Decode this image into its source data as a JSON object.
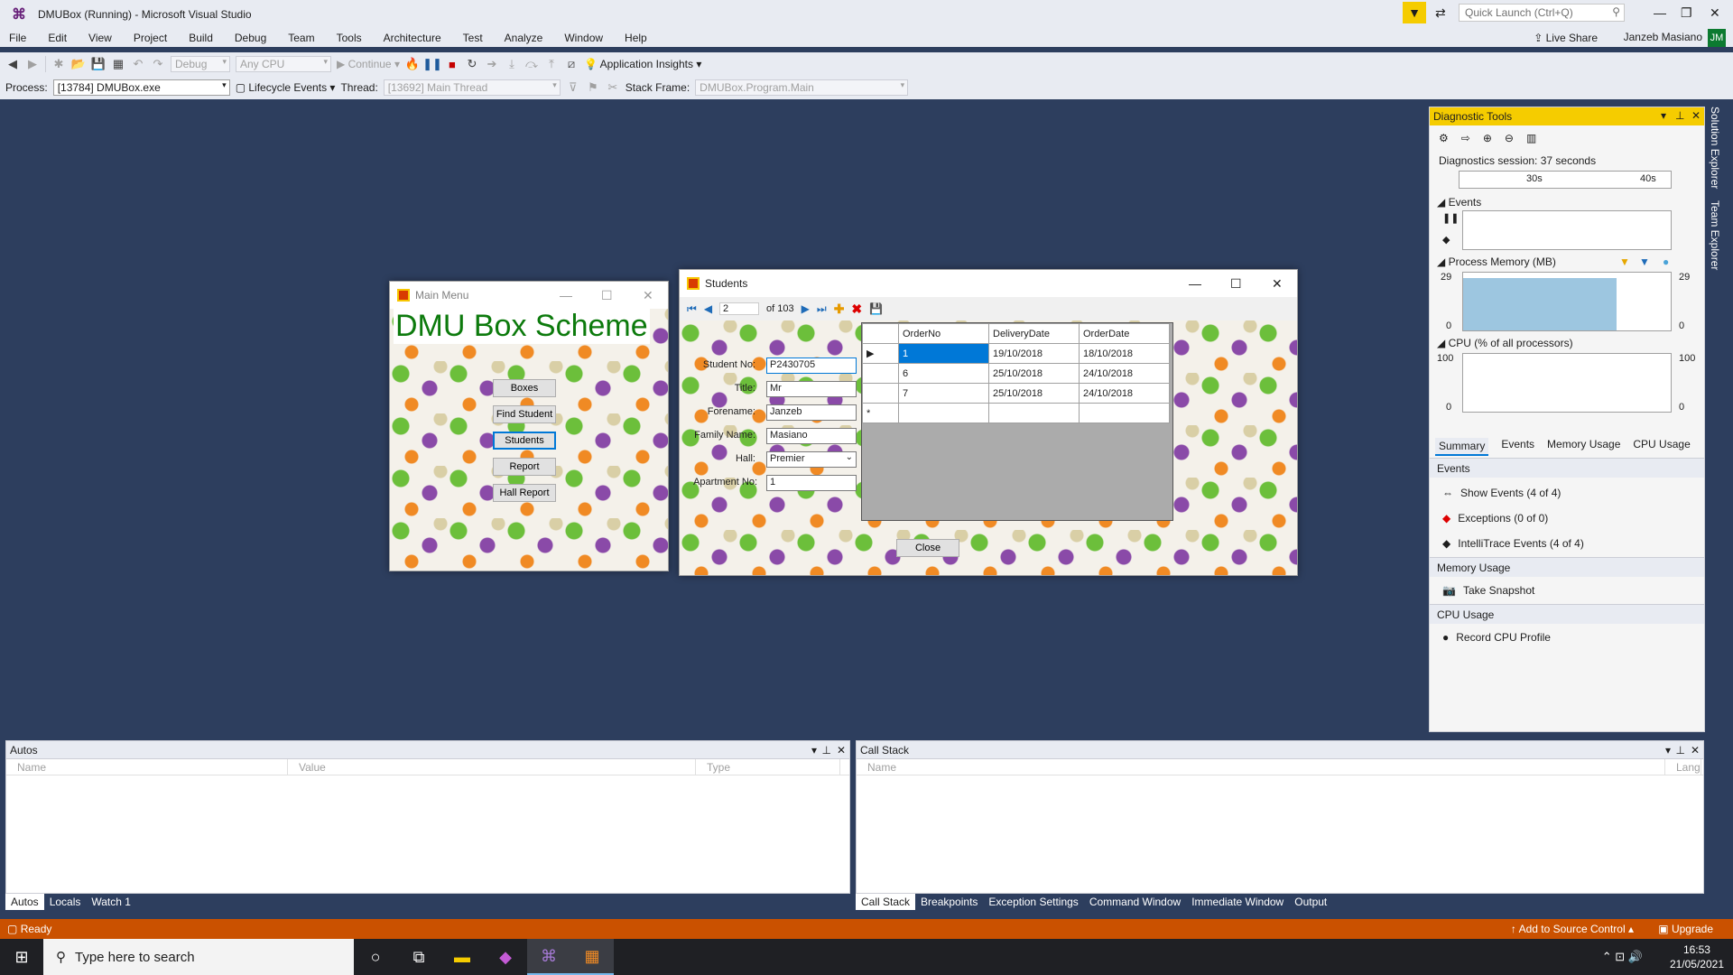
{
  "window": {
    "title": "DMUBox (Running) - Microsoft Visual Studio",
    "quick_launch_placeholder": "Quick Launch (Ctrl+Q)"
  },
  "menu": [
    "File",
    "Edit",
    "View",
    "Project",
    "Build",
    "Debug",
    "Team",
    "Tools",
    "Architecture",
    "Test",
    "Analyze",
    "Window",
    "Help"
  ],
  "account": {
    "live_share": "Live Share",
    "user": "Janzeb Masiano",
    "initials": "JM"
  },
  "toolbar1": {
    "config": "Debug",
    "platform": "Any CPU",
    "continue": "Continue",
    "app_insights": "Application Insights"
  },
  "toolbar2": {
    "process_label": "Process:",
    "process_value": "[13784] DMUBox.exe",
    "lifecycle": "Lifecycle Events",
    "thread_label": "Thread:",
    "thread_value": "[13692] Main Thread",
    "stack_label": "Stack Frame:",
    "stack_value": "DMUBox.Program.Main"
  },
  "main_menu": {
    "title": "Main Menu",
    "heading": "DMU Box Scheme",
    "buttons": [
      "Boxes",
      "Find Student",
      "Students",
      "Report",
      "Hall Report"
    ]
  },
  "students": {
    "title": "Students",
    "nav": {
      "position": "2",
      "total": "of 103"
    },
    "fields": [
      {
        "label": "Student No:",
        "value": "P2430705"
      },
      {
        "label": "Title:",
        "value": "Mr"
      },
      {
        "label": "Forename:",
        "value": "Janzeb"
      },
      {
        "label": "Family Name:",
        "value": "Masiano"
      },
      {
        "label": "Hall:",
        "value": "Premier"
      },
      {
        "label": "Apartment No:",
        "value": "1"
      }
    ],
    "grid": {
      "columns": [
        "OrderNo",
        "DeliveryDate",
        "OrderDate"
      ],
      "rows": [
        [
          "1",
          "19/10/2018",
          "18/10/2018"
        ],
        [
          "6",
          "25/10/2018",
          "24/10/2018"
        ],
        [
          "7",
          "25/10/2018",
          "24/10/2018"
        ]
      ],
      "new_row_marker": "*"
    },
    "close": "Close"
  },
  "diagnostics": {
    "title": "Diagnostic Tools",
    "session": "Diagnostics session: 37 seconds",
    "ticks": [
      "30s",
      "40s"
    ],
    "events_label": "Events",
    "memory_label": "Process Memory (MB)",
    "memory_max": "29",
    "memory_min": "0",
    "cpu_label": "CPU (% of all processors)",
    "cpu_max": "100",
    "cpu_min": "0",
    "tabs": [
      "Summary",
      "Events",
      "Memory Usage",
      "CPU Usage"
    ],
    "events_header": "Events",
    "events_items": [
      "Show Events (4 of 4)",
      "Exceptions (0 of 0)",
      "IntelliTrace Events (4 of 4)"
    ],
    "memory_header": "Memory Usage",
    "memory_item": "Take Snapshot",
    "cpu_header": "CPU Usage",
    "cpu_item": "Record CPU Profile"
  },
  "side_tabs": [
    "Solution Explorer",
    "Team Explorer"
  ],
  "autos": {
    "title": "Autos",
    "columns": [
      "Name",
      "Value",
      "Type"
    ],
    "tabs": [
      "Autos",
      "Locals",
      "Watch 1"
    ]
  },
  "callstack": {
    "title": "Call Stack",
    "columns": [
      "Name",
      "Lang"
    ],
    "tabs": [
      "Call Stack",
      "Breakpoints",
      "Exception Settings",
      "Command Window",
      "Immediate Window",
      "Output"
    ]
  },
  "status": {
    "text": "Ready",
    "source_control": "Add to Source Control",
    "upgrade": "Upgrade"
  },
  "taskbar": {
    "search_placeholder": "Type here to search",
    "time": "16:53",
    "date": "21/05/2021"
  },
  "colors": {
    "accent": "#0078d7",
    "status_bar": "#ca5100",
    "heading_green": "#0c7a0c",
    "diag_title": "#f5cc00"
  }
}
